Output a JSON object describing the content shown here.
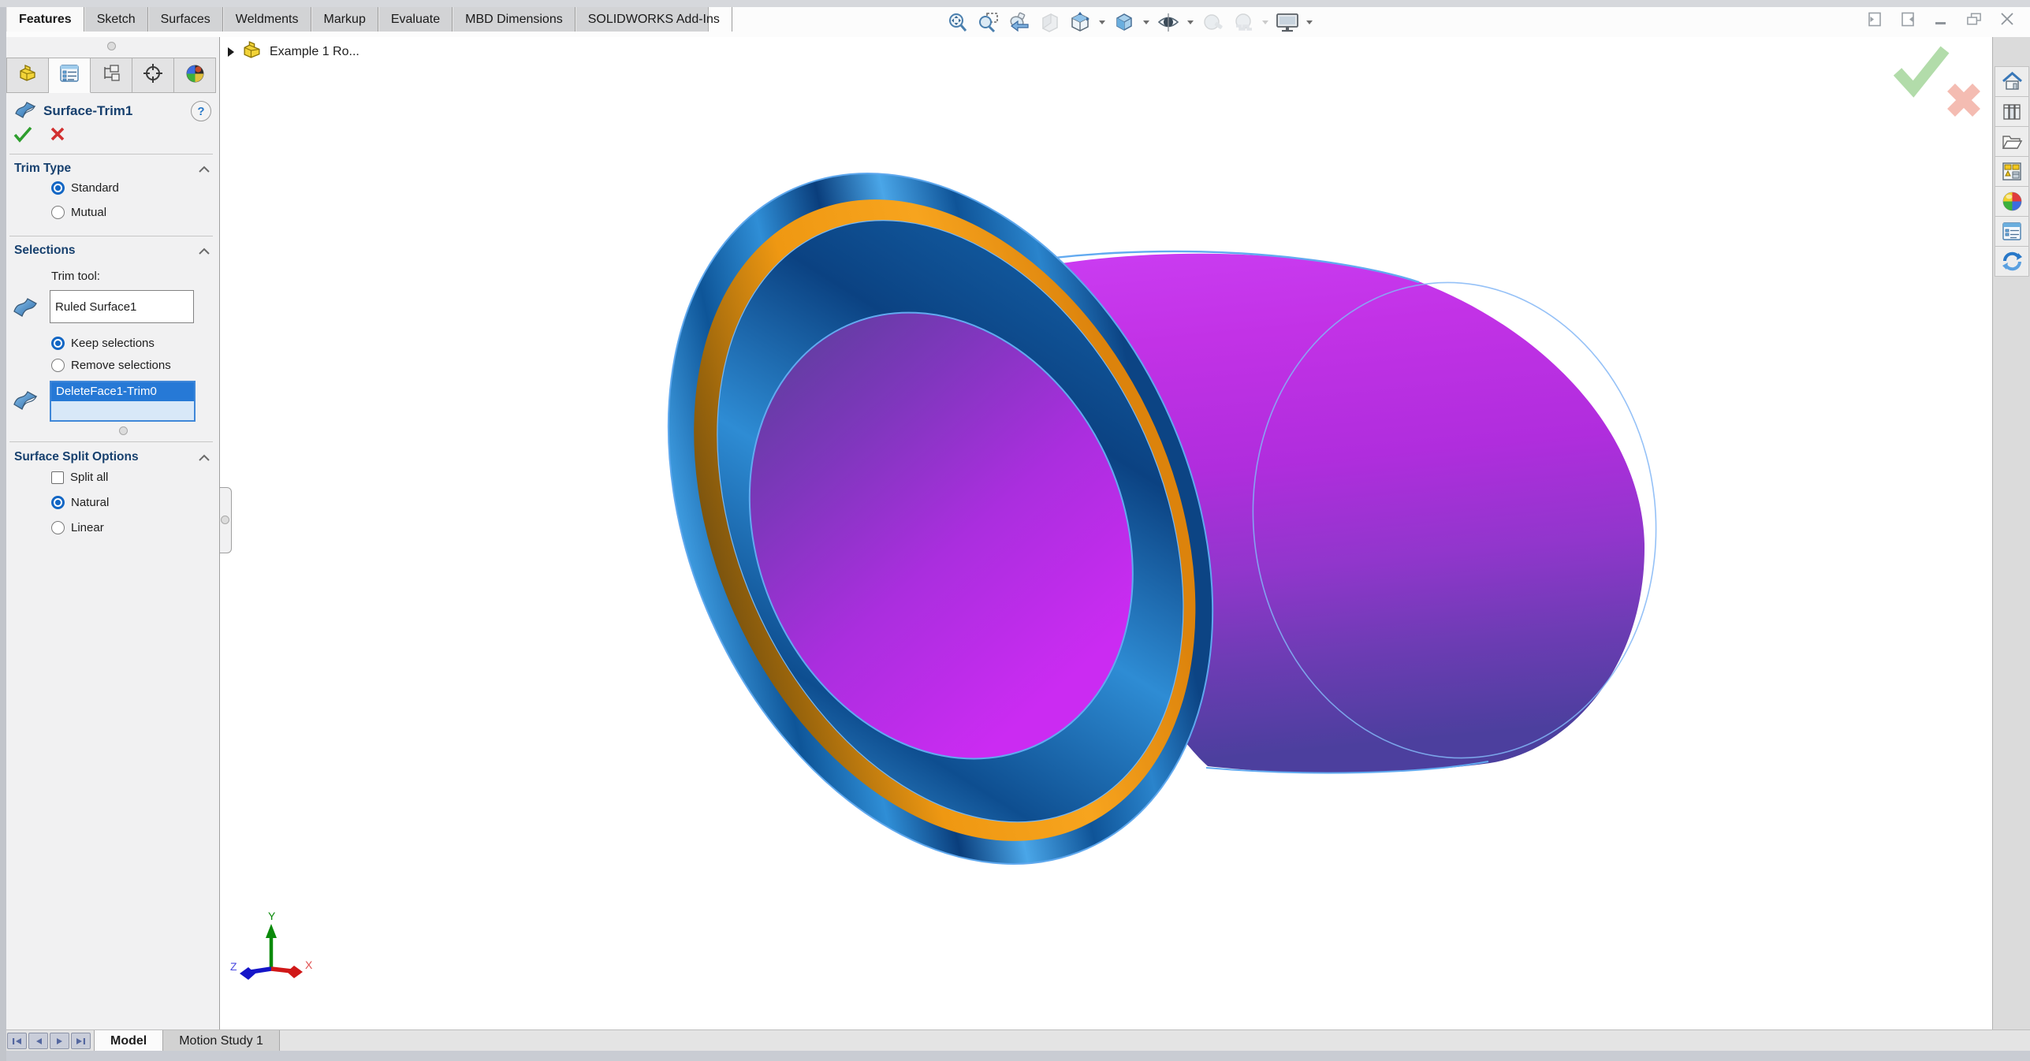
{
  "colors": {
    "accent_blue": "#2679d6",
    "model_magenta": "#c02ce2",
    "model_blue": "#1a6ab5",
    "model_orange": "#f29a12",
    "ok_green": "#2e9e2e",
    "cancel_red": "#d23030"
  },
  "ribbon": {
    "tabs": [
      {
        "label": "Features",
        "active": true
      },
      {
        "label": "Sketch",
        "active": false
      },
      {
        "label": "Surfaces",
        "active": false
      },
      {
        "label": "Weldments",
        "active": false
      },
      {
        "label": "Markup",
        "active": false
      },
      {
        "label": "Evaluate",
        "active": false
      },
      {
        "label": "MBD Dimensions",
        "active": false
      },
      {
        "label": "SOLIDWORKS Add-Ins",
        "active": false
      }
    ]
  },
  "headsup_toolbar": {
    "icons": [
      "zoom-to-fit",
      "zoom-to-area",
      "previous-view",
      "section-view",
      "view-orientation",
      "display-style",
      "hide-show-items",
      "edit-appearance",
      "apply-scene",
      "view-settings"
    ]
  },
  "window_controls": [
    "previous-pane",
    "next-pane",
    "minimize",
    "restore",
    "close"
  ],
  "property_manager": {
    "title": "Surface-Trim1",
    "help": "?",
    "tabs": [
      "feature-manager-design-tree",
      "property-manager",
      "configuration-manager",
      "dimxpert-manager",
      "display-manager"
    ],
    "trim_type": {
      "header": "Trim Type",
      "standard": {
        "label": "Standard",
        "selected": true
      },
      "mutual": {
        "label": "Mutual",
        "selected": false
      }
    },
    "selections": {
      "header": "Selections",
      "trim_tool_label": "Trim tool:",
      "trim_tool_value": "Ruled Surface1",
      "keep": {
        "label": "Keep selections",
        "selected": true
      },
      "remove": {
        "label": "Remove selections",
        "selected": false
      },
      "pieces_selected_value": "DeleteFace1-Trim0"
    },
    "surface_split": {
      "header": "Surface Split Options",
      "split_all": {
        "label": "Split all",
        "checked": false
      },
      "natural": {
        "label": "Natural",
        "selected": true
      },
      "linear": {
        "label": "Linear",
        "selected": false
      }
    }
  },
  "viewport": {
    "flyout_tree_item": "Example 1 Ro...",
    "triad": {
      "x": "X",
      "y": "Y",
      "z": "Z"
    }
  },
  "task_pane": {
    "icons": [
      "home",
      "design-library",
      "file-explorer",
      "view-palette",
      "appearances-scenes",
      "custom-properties",
      "solidworks-resources"
    ]
  },
  "bottom_bar": {
    "model_tab": "Model",
    "motion_tab": "Motion Study 1"
  }
}
